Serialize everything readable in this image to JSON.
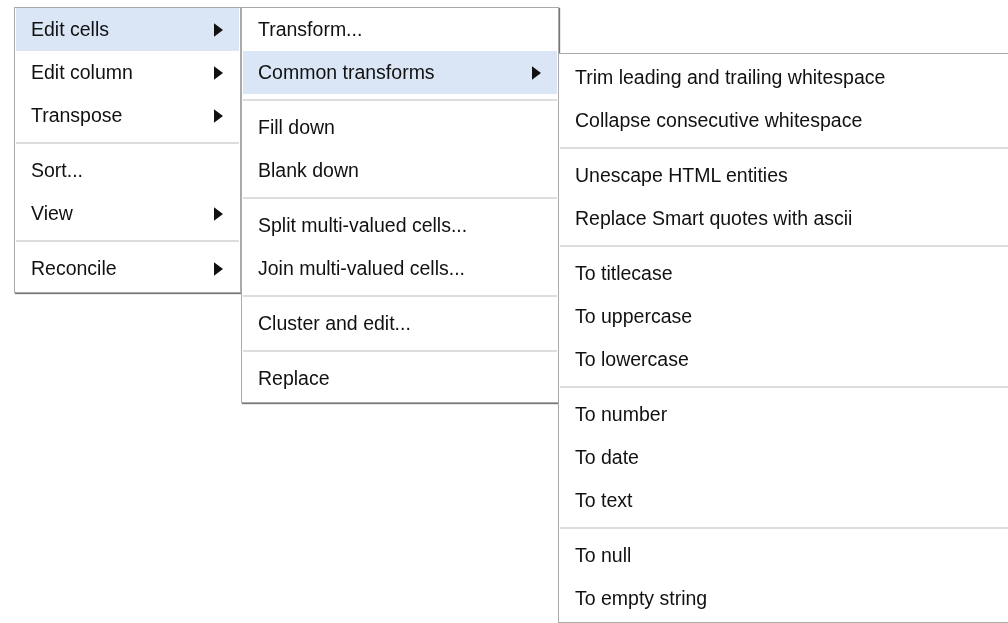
{
  "menus": [
    {
      "groups": [
        [
          {
            "label": "Edit cells",
            "selected": true,
            "has_submenu": true
          },
          {
            "label": "Edit column",
            "selected": false,
            "has_submenu": true
          },
          {
            "label": "Transpose",
            "selected": false,
            "has_submenu": true
          }
        ],
        [
          {
            "label": "Sort...",
            "selected": false,
            "has_submenu": false
          },
          {
            "label": "View",
            "selected": false,
            "has_submenu": true
          }
        ],
        [
          {
            "label": "Reconcile",
            "selected": false,
            "has_submenu": true
          }
        ]
      ]
    },
    {
      "groups": [
        [
          {
            "label": "Transform...",
            "selected": false,
            "has_submenu": false
          },
          {
            "label": "Common transforms",
            "selected": true,
            "has_submenu": true
          }
        ],
        [
          {
            "label": "Fill down",
            "selected": false,
            "has_submenu": false
          },
          {
            "label": "Blank down",
            "selected": false,
            "has_submenu": false
          }
        ],
        [
          {
            "label": "Split multi-valued cells...",
            "selected": false,
            "has_submenu": false
          },
          {
            "label": "Join multi-valued cells...",
            "selected": false,
            "has_submenu": false
          }
        ],
        [
          {
            "label": "Cluster and edit...",
            "selected": false,
            "has_submenu": false
          }
        ],
        [
          {
            "label": "Replace",
            "selected": false,
            "has_submenu": false
          }
        ]
      ]
    },
    {
      "groups": [
        [
          {
            "label": "Trim leading and trailing whitespace",
            "selected": false,
            "has_submenu": false
          },
          {
            "label": "Collapse consecutive whitespace",
            "selected": false,
            "has_submenu": false
          }
        ],
        [
          {
            "label": "Unescape HTML entities",
            "selected": false,
            "has_submenu": false
          },
          {
            "label": "Replace Smart quotes with ascii",
            "selected": false,
            "has_submenu": false
          }
        ],
        [
          {
            "label": "To titlecase",
            "selected": false,
            "has_submenu": false
          },
          {
            "label": "To uppercase",
            "selected": false,
            "has_submenu": false
          },
          {
            "label": "To lowercase",
            "selected": false,
            "has_submenu": false
          }
        ],
        [
          {
            "label": "To number",
            "selected": false,
            "has_submenu": false
          },
          {
            "label": "To date",
            "selected": false,
            "has_submenu": false
          },
          {
            "label": "To text",
            "selected": false,
            "has_submenu": false
          }
        ],
        [
          {
            "label": "To null",
            "selected": false,
            "has_submenu": false
          },
          {
            "label": "To empty string",
            "selected": false,
            "has_submenu": false
          }
        ]
      ]
    }
  ]
}
